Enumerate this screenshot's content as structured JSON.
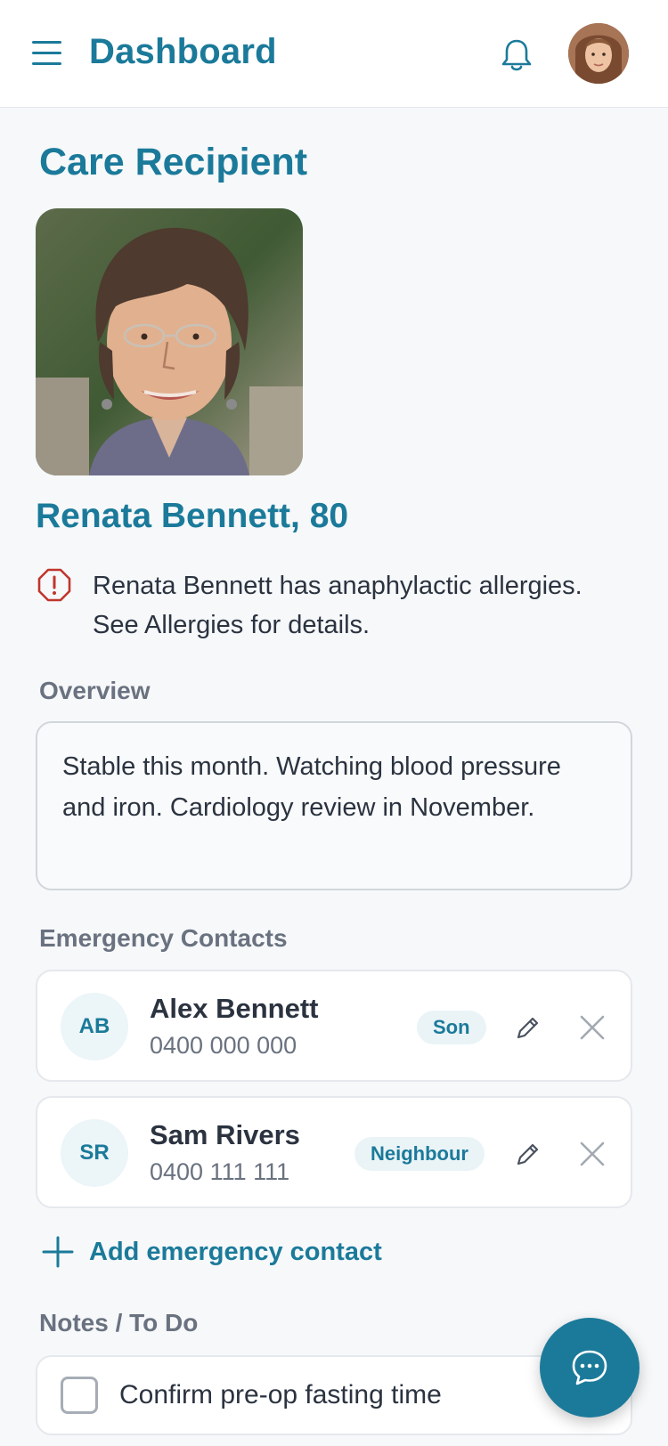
{
  "header": {
    "title": "Dashboard",
    "menu_icon": "hamburger-menu-icon",
    "notification_icon": "bell-icon",
    "avatar_icon": "user-avatar"
  },
  "page": {
    "section_title": "Care Recipient",
    "recipient_name": "Renata Bennett, 80",
    "alert": {
      "line1": "Renata Bennett has anaphylactic allergies.",
      "line2": "See Allergies for details.",
      "icon": "warning-octagon-icon"
    },
    "overview_label": "Overview",
    "overview_text": "Stable this month. Watching blood pressure and iron. Cardiology review in November.",
    "emergency_label": "Emergency Contacts",
    "contacts": [
      {
        "initials": "AB",
        "name": "Alex Bennett",
        "phone": "0400 000 000",
        "relation": "Son"
      },
      {
        "initials": "SR",
        "name": "Sam Rivers",
        "phone": "0400 111 111",
        "relation": "Neighbour"
      }
    ],
    "add_contact_label": "Add emergency contact",
    "notes_label": "Notes / To Do",
    "todos": [
      {
        "text": "Confirm pre-op fasting time",
        "checked": false
      }
    ]
  },
  "colors": {
    "brand": "#1b7a9a",
    "alert": "#c0362c",
    "muted": "#6a7280",
    "background": "#f6f8fa"
  }
}
